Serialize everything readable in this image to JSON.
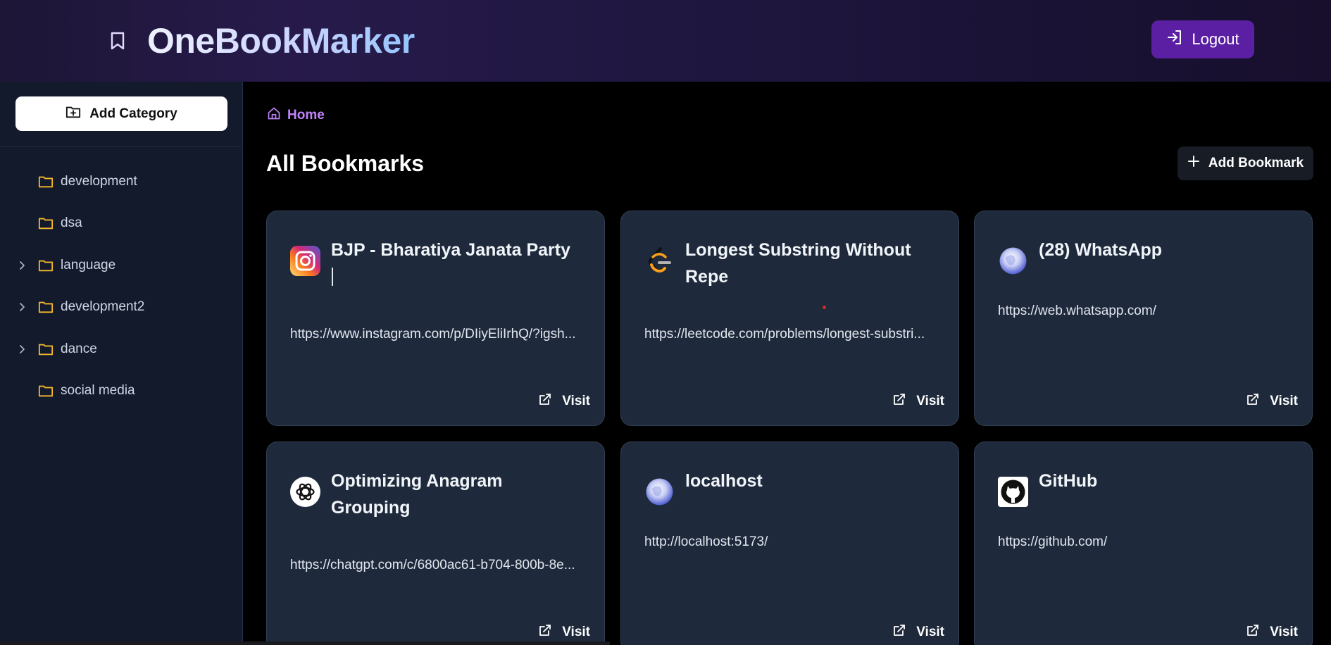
{
  "header": {
    "title": "OneBookMarker",
    "logout_label": "Logout",
    "accent_color": "#5b1fa3"
  },
  "sidebar": {
    "add_category_label": "Add Category",
    "categories": [
      {
        "label": "development",
        "expandable": false
      },
      {
        "label": "dsa",
        "expandable": false
      },
      {
        "label": "language",
        "expandable": true
      },
      {
        "label": "development2",
        "expandable": true
      },
      {
        "label": "dance",
        "expandable": true
      },
      {
        "label": "social media",
        "expandable": false
      }
    ],
    "folder_color": "#f5b82e"
  },
  "main": {
    "breadcrumb": "Home",
    "page_title": "All Bookmarks",
    "add_bookmark_label": "Add Bookmark",
    "visit_label": "Visit",
    "cards": [
      {
        "icon": "instagram-icon",
        "title": "BJP - Bharatiya Janata Party",
        "url": "https://www.instagram.com/p/DIiyEliIrhQ/?igsh..."
      },
      {
        "icon": "leetcode-icon",
        "title": "Longest Substring Without Repe",
        "url": "https://leetcode.com/problems/longest-substri..."
      },
      {
        "icon": "globe-icon",
        "title": "(28) WhatsApp",
        "url": "https://web.whatsapp.com/"
      },
      {
        "icon": "chatgpt-icon",
        "title": "Optimizing Anagram Grouping",
        "url": "https://chatgpt.com/c/6800ac61-b704-800b-8e..."
      },
      {
        "icon": "globe-icon",
        "title": "localhost",
        "url": "http://localhost:5173/"
      },
      {
        "icon": "github-icon",
        "title": "GitHub",
        "url": "https://github.com/"
      }
    ]
  }
}
